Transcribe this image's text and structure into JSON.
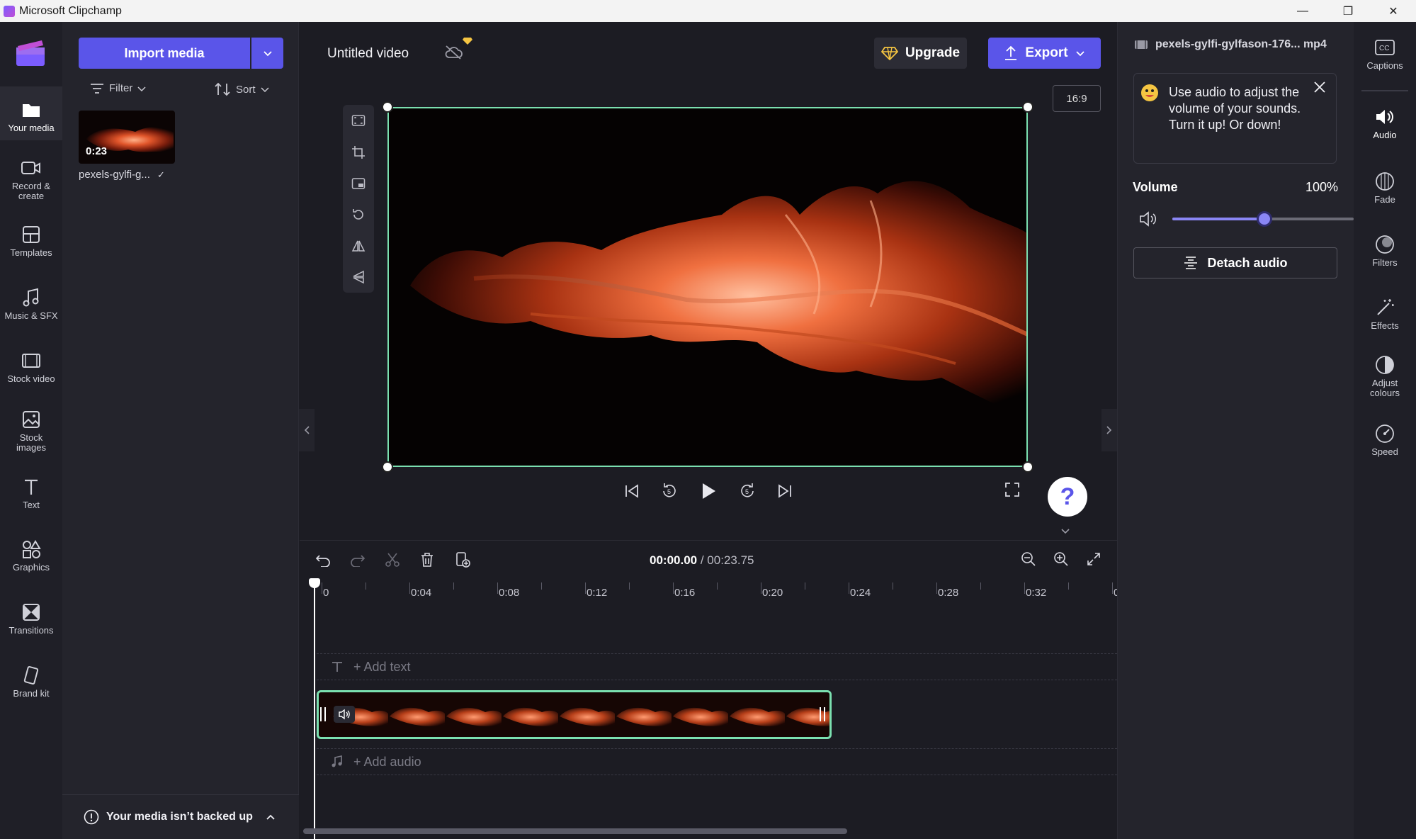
{
  "window": {
    "title": "Microsoft Clipchamp",
    "controls": [
      "minimize-icon",
      "restore-icon",
      "close-icon"
    ]
  },
  "left_rail": {
    "items": [
      {
        "label": "Your media",
        "icon": "folder-icon",
        "active": true
      },
      {
        "label": "Record &\ncreate",
        "icon": "camera-icon"
      },
      {
        "label": "Templates",
        "icon": "templates-icon"
      },
      {
        "label": "Music & SFX",
        "icon": "music-icon"
      },
      {
        "label": "Stock video",
        "icon": "film-icon"
      },
      {
        "label": "Stock\nimages",
        "icon": "image-icon"
      },
      {
        "label": "Text",
        "icon": "text-icon"
      },
      {
        "label": "Graphics",
        "icon": "shapes-icon"
      },
      {
        "label": "Transitions",
        "icon": "transitions-icon"
      },
      {
        "label": "Brand kit",
        "icon": "brand-icon"
      }
    ]
  },
  "media_panel": {
    "import_label": "Import media",
    "filter_label": "Filter",
    "sort_label": "Sort",
    "items": [
      {
        "name": "pexels-gylfi-g...",
        "duration": "0:23",
        "checked": true
      }
    ],
    "backup_text": "Your media isn’t backed up"
  },
  "header": {
    "project_title": "Untitled video",
    "upgrade_label": "Upgrade",
    "export_label": "Export"
  },
  "preview": {
    "aspect_ratio": "16:9",
    "tools": [
      "fit-icon",
      "crop-icon",
      "pip-icon",
      "rotate-icon",
      "flip-horizontal-icon",
      "flip-vertical-icon"
    ]
  },
  "timeline": {
    "current_time": "00:00.00",
    "total_time": "/ 00:23.75",
    "ruler_labels": [
      "0",
      "0:04",
      "0:08",
      "0:12",
      "0:16",
      "0:20",
      "0:24",
      "0:28",
      "0:32",
      "0:"
    ],
    "add_text_label": "+ Add text",
    "add_audio_label": "+ Add audio"
  },
  "properties": {
    "filename": "pexels-gylfi-gylfason-176... mp4",
    "tip_text": "Use audio to adjust the volume of your sounds. Turn it up! Or down!",
    "volume_label": "Volume",
    "volume_value": "100%",
    "volume_level": 0.5,
    "detach_label": "Detach audio"
  },
  "right_rail": {
    "items": [
      {
        "label": "Captions",
        "icon": "captions-icon"
      },
      {
        "label": "Audio",
        "icon": "speaker-icon",
        "active": true
      },
      {
        "label": "Fade",
        "icon": "fade-icon"
      },
      {
        "label": "Filters",
        "icon": "filters-icon"
      },
      {
        "label": "Effects",
        "icon": "effects-icon"
      },
      {
        "label": "Adjust\ncolours",
        "icon": "adjust-colours-icon"
      },
      {
        "label": "Speed",
        "icon": "speed-icon"
      }
    ]
  },
  "colors": {
    "accent": "#5a55e9",
    "selection": "#7be0b0",
    "background": "#1c1c23"
  }
}
